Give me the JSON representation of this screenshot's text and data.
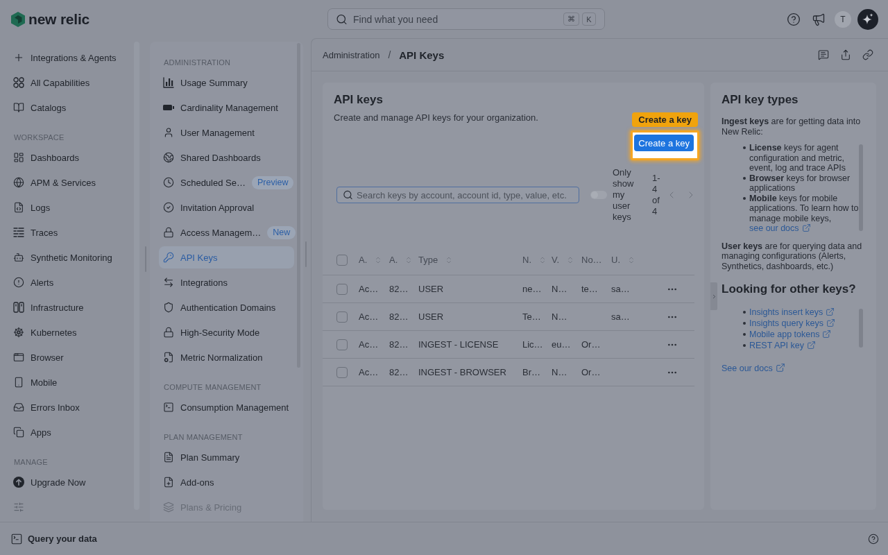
{
  "top_bar": {
    "brand": "new relic",
    "search": {
      "placeholder": "Find what you need",
      "shortcut": [
        "⌘",
        "K"
      ]
    },
    "avatar": "T"
  },
  "sidebar": {
    "sections": [
      {
        "items": [
          "Integrations & Agents",
          "All Capabilities",
          "Catalogs"
        ]
      },
      {
        "heading": "WORKSPACE",
        "items": [
          "Dashboards",
          "APM & Services",
          "Logs",
          "Traces",
          "Synthetic Monitoring",
          "Alerts",
          "Infrastructure",
          "Kubernetes",
          "Browser",
          "Mobile",
          "Errors Inbox",
          "Apps"
        ]
      },
      {
        "heading": "MANAGE",
        "items": [
          "Upgrade Now"
        ]
      }
    ]
  },
  "admin_nav": {
    "sections": [
      {
        "heading": "ADMINISTRATION",
        "items": [
          {
            "label": "Usage Summary",
            "selected": false,
            "disabled": false
          },
          {
            "label": "Cardinality Management",
            "selected": false,
            "disabled": false
          },
          {
            "label": "User Management",
            "selected": false,
            "disabled": false
          },
          {
            "label": "Shared Dashboards",
            "selected": false,
            "disabled": false
          },
          {
            "label": "Scheduled Se…",
            "badge": "Preview",
            "selected": false,
            "disabled": false
          },
          {
            "label": "Invitation Approval",
            "selected": false,
            "disabled": false
          },
          {
            "label": "Access Managem…",
            "badge": "New",
            "selected": false,
            "disabled": false
          },
          {
            "label": "API Keys",
            "selected": true,
            "disabled": false
          },
          {
            "label": "Integrations",
            "selected": false,
            "disabled": false
          },
          {
            "label": "Authentication Domains",
            "selected": false,
            "disabled": false
          },
          {
            "label": "High-Security Mode",
            "selected": false,
            "disabled": false
          },
          {
            "label": "Metric Normalization",
            "selected": false,
            "disabled": false
          }
        ]
      },
      {
        "heading": "COMPUTE MANAGEMENT",
        "items": [
          {
            "label": "Consumption Management",
            "selected": false,
            "disabled": false
          }
        ]
      },
      {
        "heading": "PLAN MANAGEMENT",
        "items": [
          {
            "label": "Plan Summary",
            "selected": false,
            "disabled": false
          },
          {
            "label": "Add-ons",
            "selected": false,
            "disabled": false
          },
          {
            "label": "Plans & Pricing",
            "selected": false,
            "disabled": true
          }
        ]
      }
    ]
  },
  "breadcrumb": {
    "items": [
      "Administration",
      "API Keys"
    ],
    "separator": "/"
  },
  "api_keys": {
    "title": "API keys",
    "description": "Create and manage API keys for your organization.",
    "tour_tooltip": "Create a key",
    "create_button": "Create a key",
    "search": {
      "placeholder": "Search keys by account, account id, type, value, etc."
    },
    "user_keys_toggle": {
      "label": "Only show my user keys",
      "on": false
    },
    "pagination": "1-4 of 4",
    "table": {
      "select_all_checked": false,
      "columns": [
        {
          "label": "A.",
          "sortable": true
        },
        {
          "label": "A.",
          "sortable": true
        },
        {
          "label": "Type",
          "sortable": true
        },
        {
          "label": "N.",
          "sortable": true
        },
        {
          "label": "V.",
          "sortable": true
        },
        {
          "label": "No…",
          "sortable": false
        },
        {
          "label": "U.",
          "sortable": true
        }
      ],
      "rows": [
        {
          "checked": false,
          "cells": [
            "Ac…",
            "82…",
            "USER",
            "ne…",
            "N…",
            "te…",
            "sa…"
          ]
        },
        {
          "checked": false,
          "cells": [
            "Ac…",
            "82…",
            "USER",
            "Te…",
            "N…",
            null,
            "sa…"
          ]
        },
        {
          "checked": false,
          "cells": [
            "Ac…",
            "82…",
            "INGEST - LICENSE",
            "Lic…",
            "eu…",
            "Or…",
            null
          ]
        },
        {
          "checked": false,
          "cells": [
            "Ac…",
            "82…",
            "INGEST - BROWSER",
            "Br…",
            "N…",
            "Or…",
            null
          ]
        }
      ]
    }
  },
  "key_types": {
    "title": "API key types",
    "ingest_intro": "**Ingest keys** are for getting data into New Relic:",
    "ingest_list": [
      {
        "text": "**License** keys for agent configuration and metric, event, log and trace APIs"
      },
      {
        "text": "**Browser** keys for browser applications"
      },
      {
        "text": "**Mobile** keys for mobile applications. To learn how to manage mobile keys,",
        "link": "see our docs"
      }
    ],
    "user_keys": "**User keys** are for querying data and managing configurations (Alerts, Synthetics, dashboards, etc.)",
    "other_title": "Looking for other keys?",
    "other_links": [
      "Insights insert keys",
      "Insights query keys",
      "Mobile app tokens",
      "REST API key"
    ],
    "docs_link": "See our docs"
  },
  "footer": {
    "label": "Query your data"
  }
}
